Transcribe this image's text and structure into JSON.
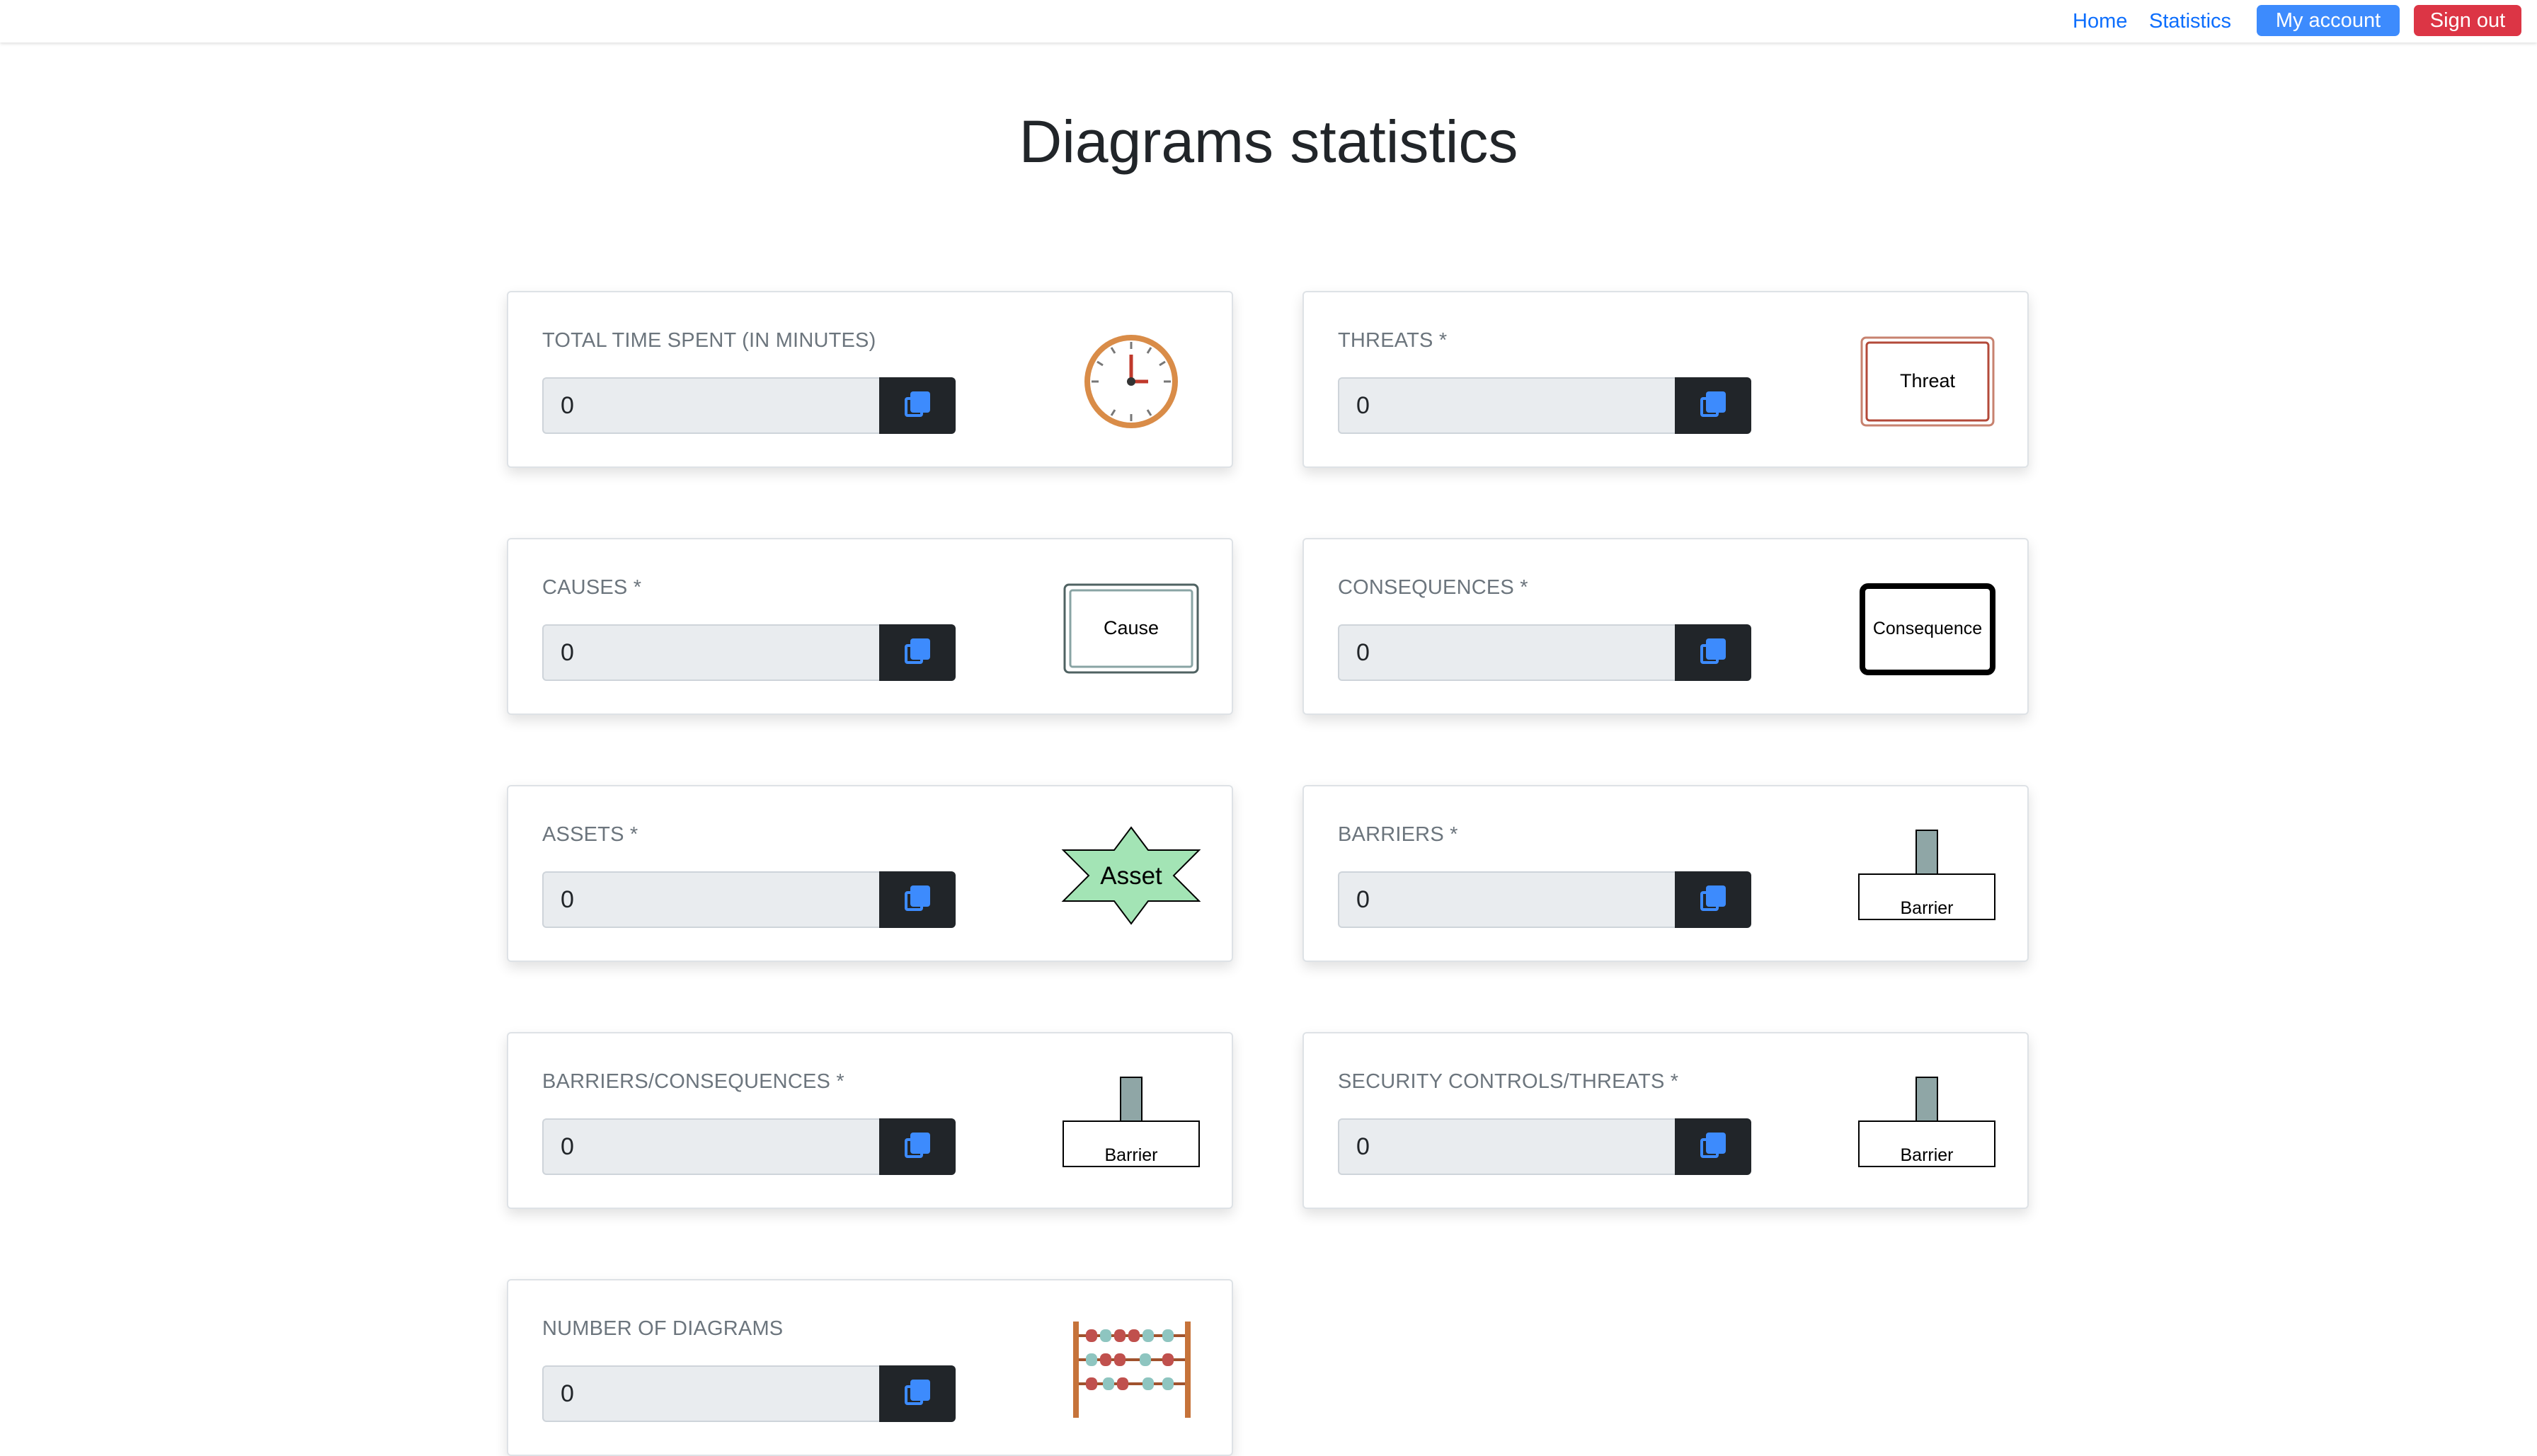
{
  "nav": {
    "home": "Home",
    "statistics": "Statistics",
    "account": "My account",
    "signout": "Sign out"
  },
  "page": {
    "title": "Diagrams statistics"
  },
  "cards": [
    {
      "label": "TOTAL TIME SPENT (IN MINUTES)",
      "value": "0",
      "icon": "clock-icon"
    },
    {
      "label": "THREATS *",
      "value": "0",
      "icon": "threat-icon",
      "icon_text": "Threat"
    },
    {
      "label": "CAUSES *",
      "value": "0",
      "icon": "cause-icon",
      "icon_text": "Cause"
    },
    {
      "label": "CONSEQUENCES *",
      "value": "0",
      "icon": "consequence-icon",
      "icon_text": "Consequence"
    },
    {
      "label": "ASSETS *",
      "value": "0",
      "icon": "asset-icon",
      "icon_text": "Asset"
    },
    {
      "label": "BARRIERS *",
      "value": "0",
      "icon": "barrier-icon",
      "icon_text": "Barrier"
    },
    {
      "label": "BARRIERS/CONSEQUENCES *",
      "value": "0",
      "icon": "barrier-icon",
      "icon_text": "Barrier"
    },
    {
      "label": "SECURITY CONTROLS/THREATS *",
      "value": "0",
      "icon": "barrier-icon",
      "icon_text": "Barrier"
    },
    {
      "label": "NUMBER OF DIAGRAMS",
      "value": "0",
      "icon": "abacus-icon"
    }
  ],
  "colors": {
    "primary": "#0d6efd",
    "account_button": "#3d8bfd",
    "signout_button": "#dc3545",
    "copy_button": "#212529",
    "asset_fill": "#a3e4b5",
    "barrier_post": "#8fa6a6"
  }
}
